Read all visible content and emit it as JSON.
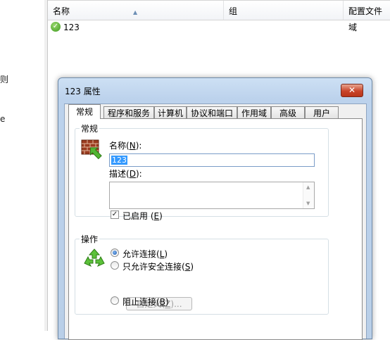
{
  "left_pane": {
    "fragments": [
      "则",
      "e"
    ]
  },
  "list": {
    "columns": [
      "名称",
      "组",
      "配置文件"
    ],
    "rows": [
      {
        "name": "123",
        "group": "",
        "profile": "域",
        "status_icon": "enabled-check-icon"
      }
    ]
  },
  "dialog": {
    "title": "123 属性",
    "close_glyph": "✕",
    "tabs": [
      "常规",
      "程序和服务",
      "计算机",
      "协议和端口",
      "作用域",
      "高级",
      "用户"
    ],
    "active_tab": "常规",
    "general": {
      "group_title": "常规",
      "name_label": "名称",
      "name_key": "N",
      "name_value": "123",
      "description_label": "描述",
      "description_key": "D",
      "description_value": "",
      "enabled_label": "已启用",
      "enabled_key": "E",
      "enabled": true
    },
    "action": {
      "group_title": "操作",
      "options": [
        {
          "label": "允许连接",
          "key": "L",
          "selected": true
        },
        {
          "label": "只允许安全连接",
          "key": "S",
          "selected": false
        },
        {
          "label": "阻止连接",
          "key": "B",
          "selected": false
        }
      ],
      "customize_label": "自定义",
      "customize_key": "Z",
      "customize_enabled": false
    }
  },
  "colors": {
    "accent": "#3399ff",
    "close_button": "#c9452a",
    "title_bar": "#bcd2ec"
  }
}
